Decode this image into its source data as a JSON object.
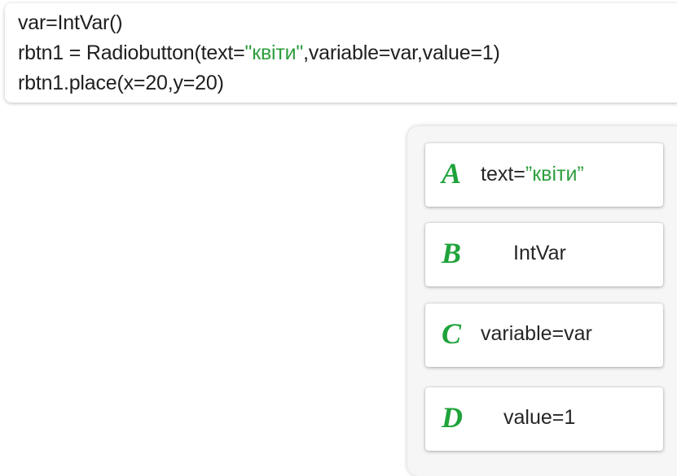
{
  "code": {
    "line1": "var=IntVar()",
    "line2_prefix": "rbtn1 = Radiobutton(text=",
    "line2_string": "\"квіти\"",
    "line2_suffix": ",variable=var,value=1)",
    "line3": "rbtn1.place(x=20,y=20)"
  },
  "options": [
    {
      "letter": "A",
      "text_prefix": "text=",
      "text_string": "”квіти”"
    },
    {
      "letter": "B",
      "text": "IntVar"
    },
    {
      "letter": "C",
      "text": "variable=var"
    },
    {
      "letter": "D",
      "text": "value=1"
    }
  ],
  "colors": {
    "string_literal": "#2e9e3e",
    "option_letter": "#1fa33a"
  }
}
